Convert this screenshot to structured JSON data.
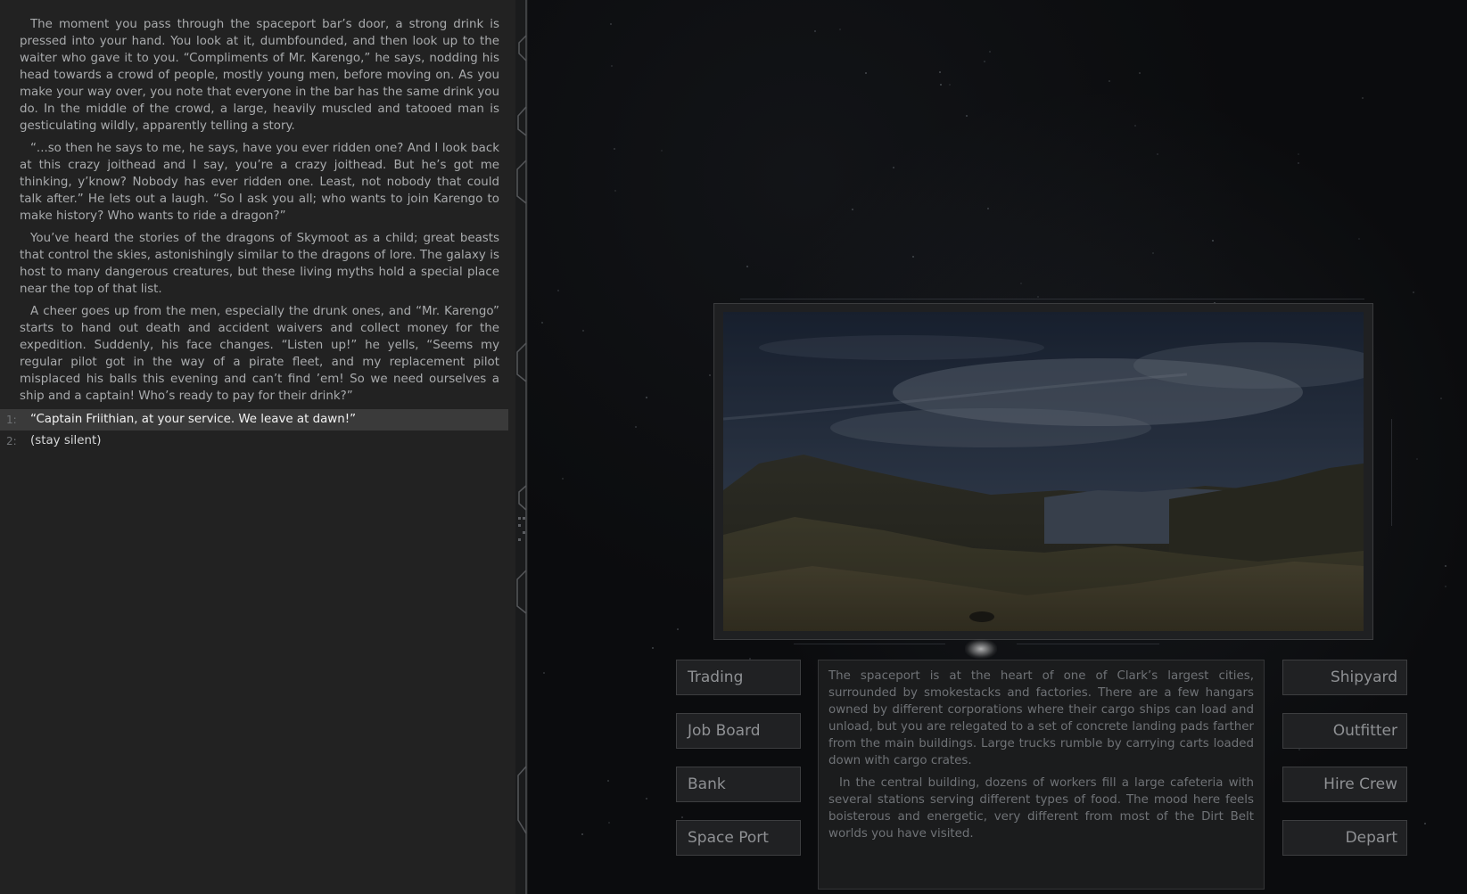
{
  "conversation": {
    "paragraphs": [
      "The moment you pass through the spaceport bar’s door, a strong drink is pressed into your hand. You look at it, dumbfounded, and then look up to the waiter who gave it to you. “Compliments of Mr. Karengo,” he says, nodding his head towards a crowd of people, mostly young men, before moving on. As you make your way over, you note that everyone in the bar has the same drink you do. In the middle of the crowd, a large, heavily muscled and tatooed man is gesticulating wildly, apparently telling a story.",
      "“...so then he says to me, he says, have you ever ridden one? And I look back at this crazy joithead and I say, you’re a crazy joithead. But he’s got me thinking, y’know? Nobody has ever ridden one. Least, not nobody that could talk after.” He lets out a laugh. “So I ask you all; who wants to join Karengo to make history? Who wants to ride a dragon?”",
      "You’ve heard the stories of the dragons of Skymoot as a child; great beasts that control the skies, astonishingly similar to the dragons of lore. The galaxy is host to many dangerous creatures, but these living myths hold a special place near the top of that list.",
      "A cheer goes up from the men, especially the drunk ones, and “Mr. Karengo” starts to hand out death and accident waivers and collect money for the expedition. Suddenly, his face changes. “Listen up!” he yells, “Seems my regular pilot got in the way of a pirate fleet, and my replacement pilot misplaced his balls this evening and can’t find ’em! So we need ourselves a ship and a captain! Who’s ready to pay for their drink?”"
    ],
    "choices": [
      {
        "number": "1:",
        "text": "“Captain Friithian, at your service. We leave at dawn!”"
      },
      {
        "number": "2:",
        "text": "(stay silent)"
      }
    ]
  },
  "planet_menu": {
    "left_buttons": [
      "Trading",
      "Job Board",
      "Bank",
      "Space Port"
    ],
    "right_buttons": [
      "Shipyard",
      "Outfitter",
      "Hire Crew",
      "Depart"
    ],
    "description": [
      "The spaceport is at the heart of one of Clark’s largest cities, surrounded by smokestacks and factories. There are a few hangars owned by different corporations where their cargo ships can load and unload, but you are relegated to a set of concrete landing pads farther from the main buildings. Large trucks rumble by carrying carts loaded down with cargo crates.",
      "In the central building, dozens of workers fill a large cafeteria with several stations serving different types of food. The mood here feels boisterous and energetic, very different from most of the Dirt Belt worlds you have visited."
    ]
  },
  "colors": {
    "panel_bg": "#222222",
    "selected_choice_bg": "#3a3a3a",
    "background": "#0b0c0e",
    "button_text": "#8f9194"
  }
}
